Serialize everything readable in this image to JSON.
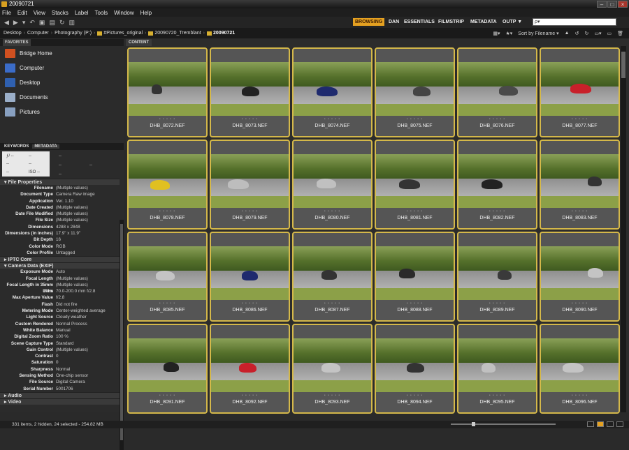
{
  "window": {
    "title": "20090721"
  },
  "menu": [
    "File",
    "Edit",
    "View",
    "Stacks",
    "Label",
    "Tools",
    "Window",
    "Help"
  ],
  "workspaces": [
    "BROWSING",
    "DAN",
    "ESSENTIALS",
    "FILMSTRIP",
    "METADATA",
    "OUTP ▼"
  ],
  "search": {
    "placeholder": "ρ▾"
  },
  "path": [
    "Desktop",
    "Computer",
    "Photography (P:)",
    "#Pictures_original",
    "20090720_Tremblant",
    "20090721"
  ],
  "sort": {
    "label": "Sort by Filename ▾"
  },
  "favorites": {
    "tab": "FAVORITES",
    "items": [
      "Bridge Home",
      "Computer",
      "Desktop",
      "Documents",
      "Pictures"
    ]
  },
  "meta_tabs": [
    "KEYWORDS",
    "METADATA"
  ],
  "placard": {
    "aperture": "ƒ/ --",
    "shutter": "--",
    "ev": "--",
    "wb": "--",
    "iso": "ISO --",
    "res": "--",
    "f1": "--",
    "f2": "--",
    "f3": "--",
    "f4": "--"
  },
  "file_properties": {
    "title": "File Properties",
    "rows": [
      [
        "Filename",
        "(Multiple values)"
      ],
      [
        "Document Type",
        "Camera Raw image"
      ],
      [
        "Application",
        "Ver. 1.10"
      ],
      [
        "Date Created",
        "(Multiple values)"
      ],
      [
        "Date File Modified",
        "(Multiple values)"
      ],
      [
        "File Size",
        "(Multiple values)"
      ],
      [
        "Dimensions",
        "4288 x 2848"
      ],
      [
        "Dimensions (in inches)",
        "17.9\" x 11.9\""
      ],
      [
        "Bit Depth",
        "16"
      ],
      [
        "Color Mode",
        "RGB"
      ],
      [
        "Color Profile",
        "Untagged"
      ]
    ]
  },
  "iptc": {
    "title": "IPTC Core"
  },
  "exif": {
    "title": "Camera Data (EXIF)",
    "rows": [
      [
        "Exposure Mode",
        "Auto"
      ],
      [
        "Focal Length",
        "(Multiple values)"
      ],
      [
        "Focal Length in 35mm Film",
        "(Multiple values)"
      ],
      [
        "Lens",
        "70.0-200.0 mm f/2.8"
      ],
      [
        "Max Aperture Value",
        "f/2.8"
      ],
      [
        "Flash",
        "Did not fire"
      ],
      [
        "Metering Mode",
        "Center-weighted average"
      ],
      [
        "Light Source",
        "Cloudy weather"
      ],
      [
        "Custom Rendered",
        "Normal Process"
      ],
      [
        "White Balance",
        "Manual"
      ],
      [
        "Digital Zoom Ratio",
        "100 %"
      ],
      [
        "Scene Capture Type",
        "Standard"
      ],
      [
        "Gain Control",
        "(Multiple values)"
      ],
      [
        "Contrast",
        "0"
      ],
      [
        "Saturation",
        "0"
      ],
      [
        "Sharpness",
        "Normal"
      ],
      [
        "Sensing Method",
        "One-chip sensor"
      ],
      [
        "File Source",
        "Digital Camera"
      ],
      [
        "Serial Number",
        "5001706"
      ]
    ]
  },
  "audio": {
    "title": "Audio"
  },
  "video": {
    "title": "Video"
  },
  "content": {
    "tab": "CONTENT",
    "dots": "• • • • •",
    "thumbnails": [
      {
        "name": "DHB_8072.NEF",
        "car": "#333"
      },
      {
        "name": "DHB_8073.NEF",
        "car": "#222"
      },
      {
        "name": "DHB_8074.NEF",
        "car": "#1f2a6e"
      },
      {
        "name": "DHB_8075.NEF",
        "car": "#444"
      },
      {
        "name": "DHB_8076.NEF",
        "car": "#4a4a4a"
      },
      {
        "name": "DHB_8077.NEF",
        "car": "#c8202a"
      },
      {
        "name": "DHB_8078.NEF",
        "car": "#e0c020"
      },
      {
        "name": "DHB_8079.NEF",
        "car": "#bdbdbd"
      },
      {
        "name": "DHB_8080.NEF",
        "car": "#c0c0c0"
      },
      {
        "name": "DHB_8081.NEF",
        "car": "#333"
      },
      {
        "name": "DHB_8082.NEF",
        "car": "#222"
      },
      {
        "name": "DHB_8083.NEF",
        "car": "#333"
      },
      {
        "name": "DHB_8085.NEF",
        "car": "#c4c4c4"
      },
      {
        "name": "DHB_8086.NEF",
        "car": "#1f2a6e"
      },
      {
        "name": "DHB_8087.NEF",
        "car": "#333"
      },
      {
        "name": "DHB_8088.NEF",
        "car": "#2a2a2a"
      },
      {
        "name": "DHB_8089.NEF",
        "car": "#3a3a3a"
      },
      {
        "name": "DHB_8090.NEF",
        "car": "#c4c4c4"
      },
      {
        "name": "DHB_8091.NEF",
        "car": "#222"
      },
      {
        "name": "DHB_8092.NEF",
        "car": "#c8202a"
      },
      {
        "name": "DHB_8093.NEF",
        "car": "#c4c4c4"
      },
      {
        "name": "DHB_8094.NEF",
        "car": "#333"
      },
      {
        "name": "DHB_8095.NEF",
        "car": "#c0c0c0"
      },
      {
        "name": "DHB_8096.NEF",
        "car": "#c4c4c4"
      }
    ]
  },
  "status": {
    "text": "331 items, 2 hidden, 24 selected - 254.82 MB"
  }
}
